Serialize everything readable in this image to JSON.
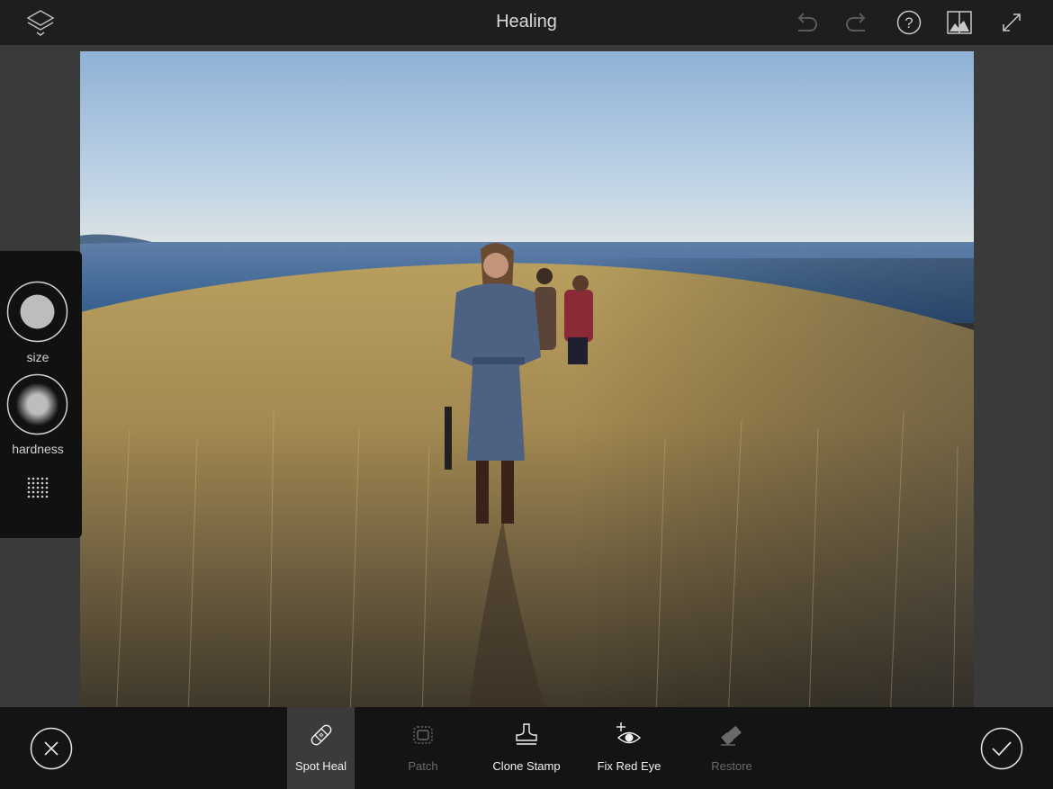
{
  "header": {
    "title": "Healing",
    "icons": [
      "layers-icon",
      "undo-icon",
      "redo-icon",
      "help-icon",
      "compare-icon",
      "fullscreen-icon"
    ]
  },
  "brush_panel": {
    "size_label": "size",
    "hardness_label": "hardness"
  },
  "toolbar": {
    "cancel_icon": "close-icon",
    "confirm_icon": "checkmark-icon",
    "tools": [
      {
        "label": "Spot Heal",
        "icon": "bandage-icon",
        "state": "active"
      },
      {
        "label": "Patch",
        "icon": "patch-icon",
        "state": "disabled"
      },
      {
        "label": "Clone Stamp",
        "icon": "stamp-icon",
        "state": "enabled"
      },
      {
        "label": "Fix Red Eye",
        "icon": "red-eye-icon",
        "state": "enabled"
      },
      {
        "label": "Restore",
        "icon": "eraser-icon",
        "state": "disabled"
      }
    ]
  },
  "colors": {
    "active_tool_bg": "#3b3b3b",
    "disabled_text": "#6a6a6a"
  }
}
